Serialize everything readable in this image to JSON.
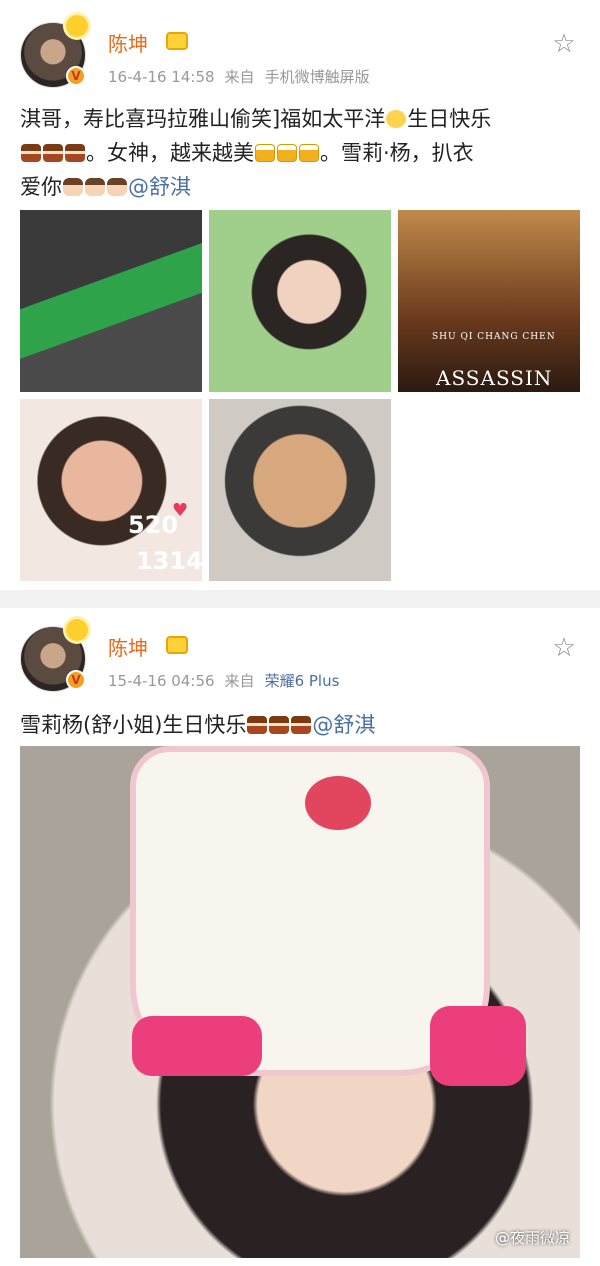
{
  "posts": [
    {
      "username": "陈坤",
      "timestamp": "16-4-16 14:58",
      "source_prefix": "来自",
      "source": "手机微博触屏版",
      "text_parts": {
        "line1_a": "淇哥，寿比喜玛拉雅山偷笑]福如太平洋",
        "line1_b": "生日快乐",
        "line2_a": "。女神，越来越美",
        "line2_b": "。雪莉·杨，扒衣",
        "line3_a": "爱你",
        "mention": "@舒淇"
      },
      "images": [
        {
          "caption": ""
        },
        {
          "caption": ""
        },
        {
          "names": "SHU QI   CHANG CHEN",
          "title": "ASSASSIN"
        },
        {
          "num_top": "520",
          "num_bottom": "1314"
        },
        {
          "caption": ""
        }
      ]
    },
    {
      "username": "陈坤",
      "timestamp": "15-4-16 04:56",
      "source_prefix": "来自",
      "source": "荣耀6 Plus",
      "text": "雪莉杨(舒小姐)生日快乐",
      "mention": "@舒淇"
    }
  ],
  "watermark": "@夜雨微凉",
  "icons": {
    "favorite": "star-outline-icon",
    "verified": "v-badge-icon",
    "member": "crown-icon",
    "weather": "sun-icon"
  },
  "colors": {
    "username": "#e86a1b",
    "link": "#4a6fa5",
    "meta": "#999999"
  }
}
